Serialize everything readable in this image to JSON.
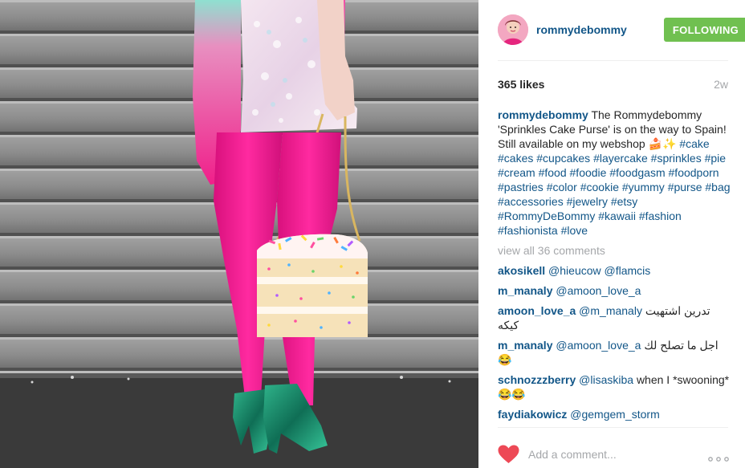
{
  "post": {
    "username": "rommydebommy",
    "follow_label": "FOLLOWING",
    "likes": "365 likes",
    "age": "2w",
    "caption": {
      "text": "The Rommydebommy 'Sprinkles Cake Purse' is on the way to Spain! Still available on my webshop 🍰✨",
      "hashtags": [
        "#cake",
        "#cakes",
        "#cupcakes",
        "#layercake",
        "#sprinkles",
        "#pie",
        "#cream",
        "#food",
        "#foodie",
        "#foodgasm",
        "#foodporn",
        "#pastries",
        "#color",
        "#cookie",
        "#yummy",
        "#purse",
        "#bag",
        "#accessories",
        "#jewelry",
        "#etsy",
        "#RommyDeBommy",
        "#kawaii",
        "#fashion",
        "#fashionista",
        "#love"
      ]
    },
    "view_all": "view all 36 comments",
    "comments": [
      {
        "user": "akosikell",
        "mention": "@hieucow @flamcis",
        "text": ""
      },
      {
        "user": "m_manaly",
        "mention": "@amoon_love_a",
        "text": ""
      },
      {
        "user": "amoon_love_a",
        "mention": "@m_manaly",
        "text": "تدرين اشتهيت كيكه"
      },
      {
        "user": "m_manaly",
        "mention": "@amoon_love_a",
        "text": "اجل ما تصلح لك 😂"
      },
      {
        "user": "schnozzzberry",
        "mention": "@lisaskiba",
        "text": "when I *swooning* 😂😂"
      },
      {
        "user": "faydiakowicz",
        "mention": "@gemgem_storm",
        "text": ""
      }
    ],
    "add_comment_placeholder": "Add a comment...",
    "more_label": "ooo"
  },
  "colors": {
    "link": "#125688",
    "follow_button": "#70c050",
    "heart": "#ed4956",
    "muted": "#a5a7aa"
  },
  "icons": {
    "heart": "heart-icon",
    "more": "more-options-icon"
  }
}
